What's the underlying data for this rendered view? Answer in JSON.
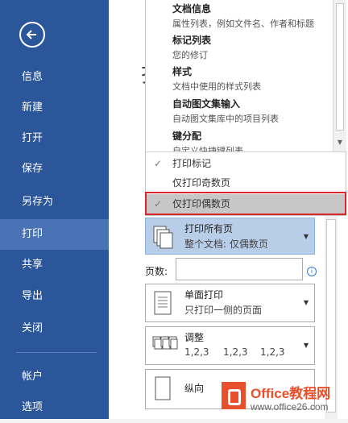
{
  "sidebar": {
    "items": [
      {
        "label": "信息"
      },
      {
        "label": "新建"
      },
      {
        "label": "打开"
      },
      {
        "label": "保存"
      },
      {
        "label": "另存为"
      },
      {
        "label": "打印"
      },
      {
        "label": "共享"
      },
      {
        "label": "导出"
      },
      {
        "label": "关闭"
      },
      {
        "label": "帐户"
      },
      {
        "label": "选项"
      }
    ],
    "selected": "打印",
    "bg_color": "#2b579a"
  },
  "background_title": "打",
  "dropdown": {
    "items": [
      {
        "title": "文档信息",
        "desc": "属性列表，例如文件名、作者和标题"
      },
      {
        "title": "标记列表",
        "desc": "您的修订"
      },
      {
        "title": "样式",
        "desc": "文档中使用的样式列表"
      },
      {
        "title": "自动图文集输入",
        "desc": "自动图文集库中的项目列表"
      },
      {
        "title": "键分配",
        "desc": "自定义快捷键列表"
      }
    ],
    "options": [
      {
        "label": "打印标记",
        "checked": true
      },
      {
        "label": "仅打印奇数页",
        "checked": false
      },
      {
        "label": "仅打印偶数页",
        "checked": true
      }
    ],
    "highlighted_option": "仅打印偶数页"
  },
  "settings": {
    "print_pages": {
      "title": "打印所有页",
      "subtitle": "整个文档: 仅偶数页"
    },
    "pages_label": "页数:",
    "pages_value": "",
    "sides": {
      "title": "单面打印",
      "subtitle": "只打印一侧的页面"
    },
    "collate": {
      "title": "调整",
      "cols": [
        "1,2,3",
        "1,2,3",
        "1,2,3"
      ]
    },
    "orientation": {
      "title": "纵向"
    }
  },
  "watermark": {
    "name": "Office教程网",
    "url": "www.office26.com"
  }
}
